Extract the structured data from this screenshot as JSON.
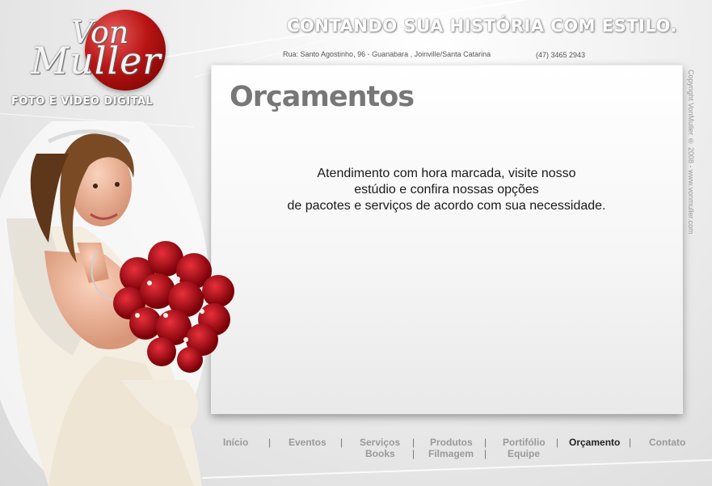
{
  "brand": {
    "logo_line1": "Von",
    "logo_line2": "Muller",
    "tagline": "FOTO E VÍDEO DIGITAL",
    "accent_color": "#b81414"
  },
  "header": {
    "slogan": "CONTANDO SUA HISTÓRIA COM ESTILO.",
    "address": "Rua: Santo Agostinho, 96 - Guanabara , Joinville/Santa Catarina",
    "phone": "(47) 3465 2943"
  },
  "main": {
    "title": "Orçamentos",
    "message_lines": [
      "Atendimento com hora marcada, visite nosso",
      "estúdio e confira nossas opções",
      "de pacotes e serviços de acordo com sua necessidade."
    ]
  },
  "side": {
    "copyright": "Copyright VonMuller ® 2008 - www.vonmuller.com"
  },
  "nav": {
    "items": [
      {
        "label": "Início",
        "active": false
      },
      {
        "label": "Eventos",
        "active": false
      },
      {
        "label": "Serviços",
        "active": false
      },
      {
        "label": "Produtos",
        "active": false
      },
      {
        "label": "Portifólio",
        "active": false
      },
      {
        "label": "Orçamento",
        "active": true
      },
      {
        "label": "Contato",
        "active": false
      },
      {
        "label": "Books",
        "active": false
      },
      {
        "label": "Filmagem",
        "active": false
      },
      {
        "label": "Equipe",
        "active": false
      }
    ],
    "separator": "|"
  }
}
